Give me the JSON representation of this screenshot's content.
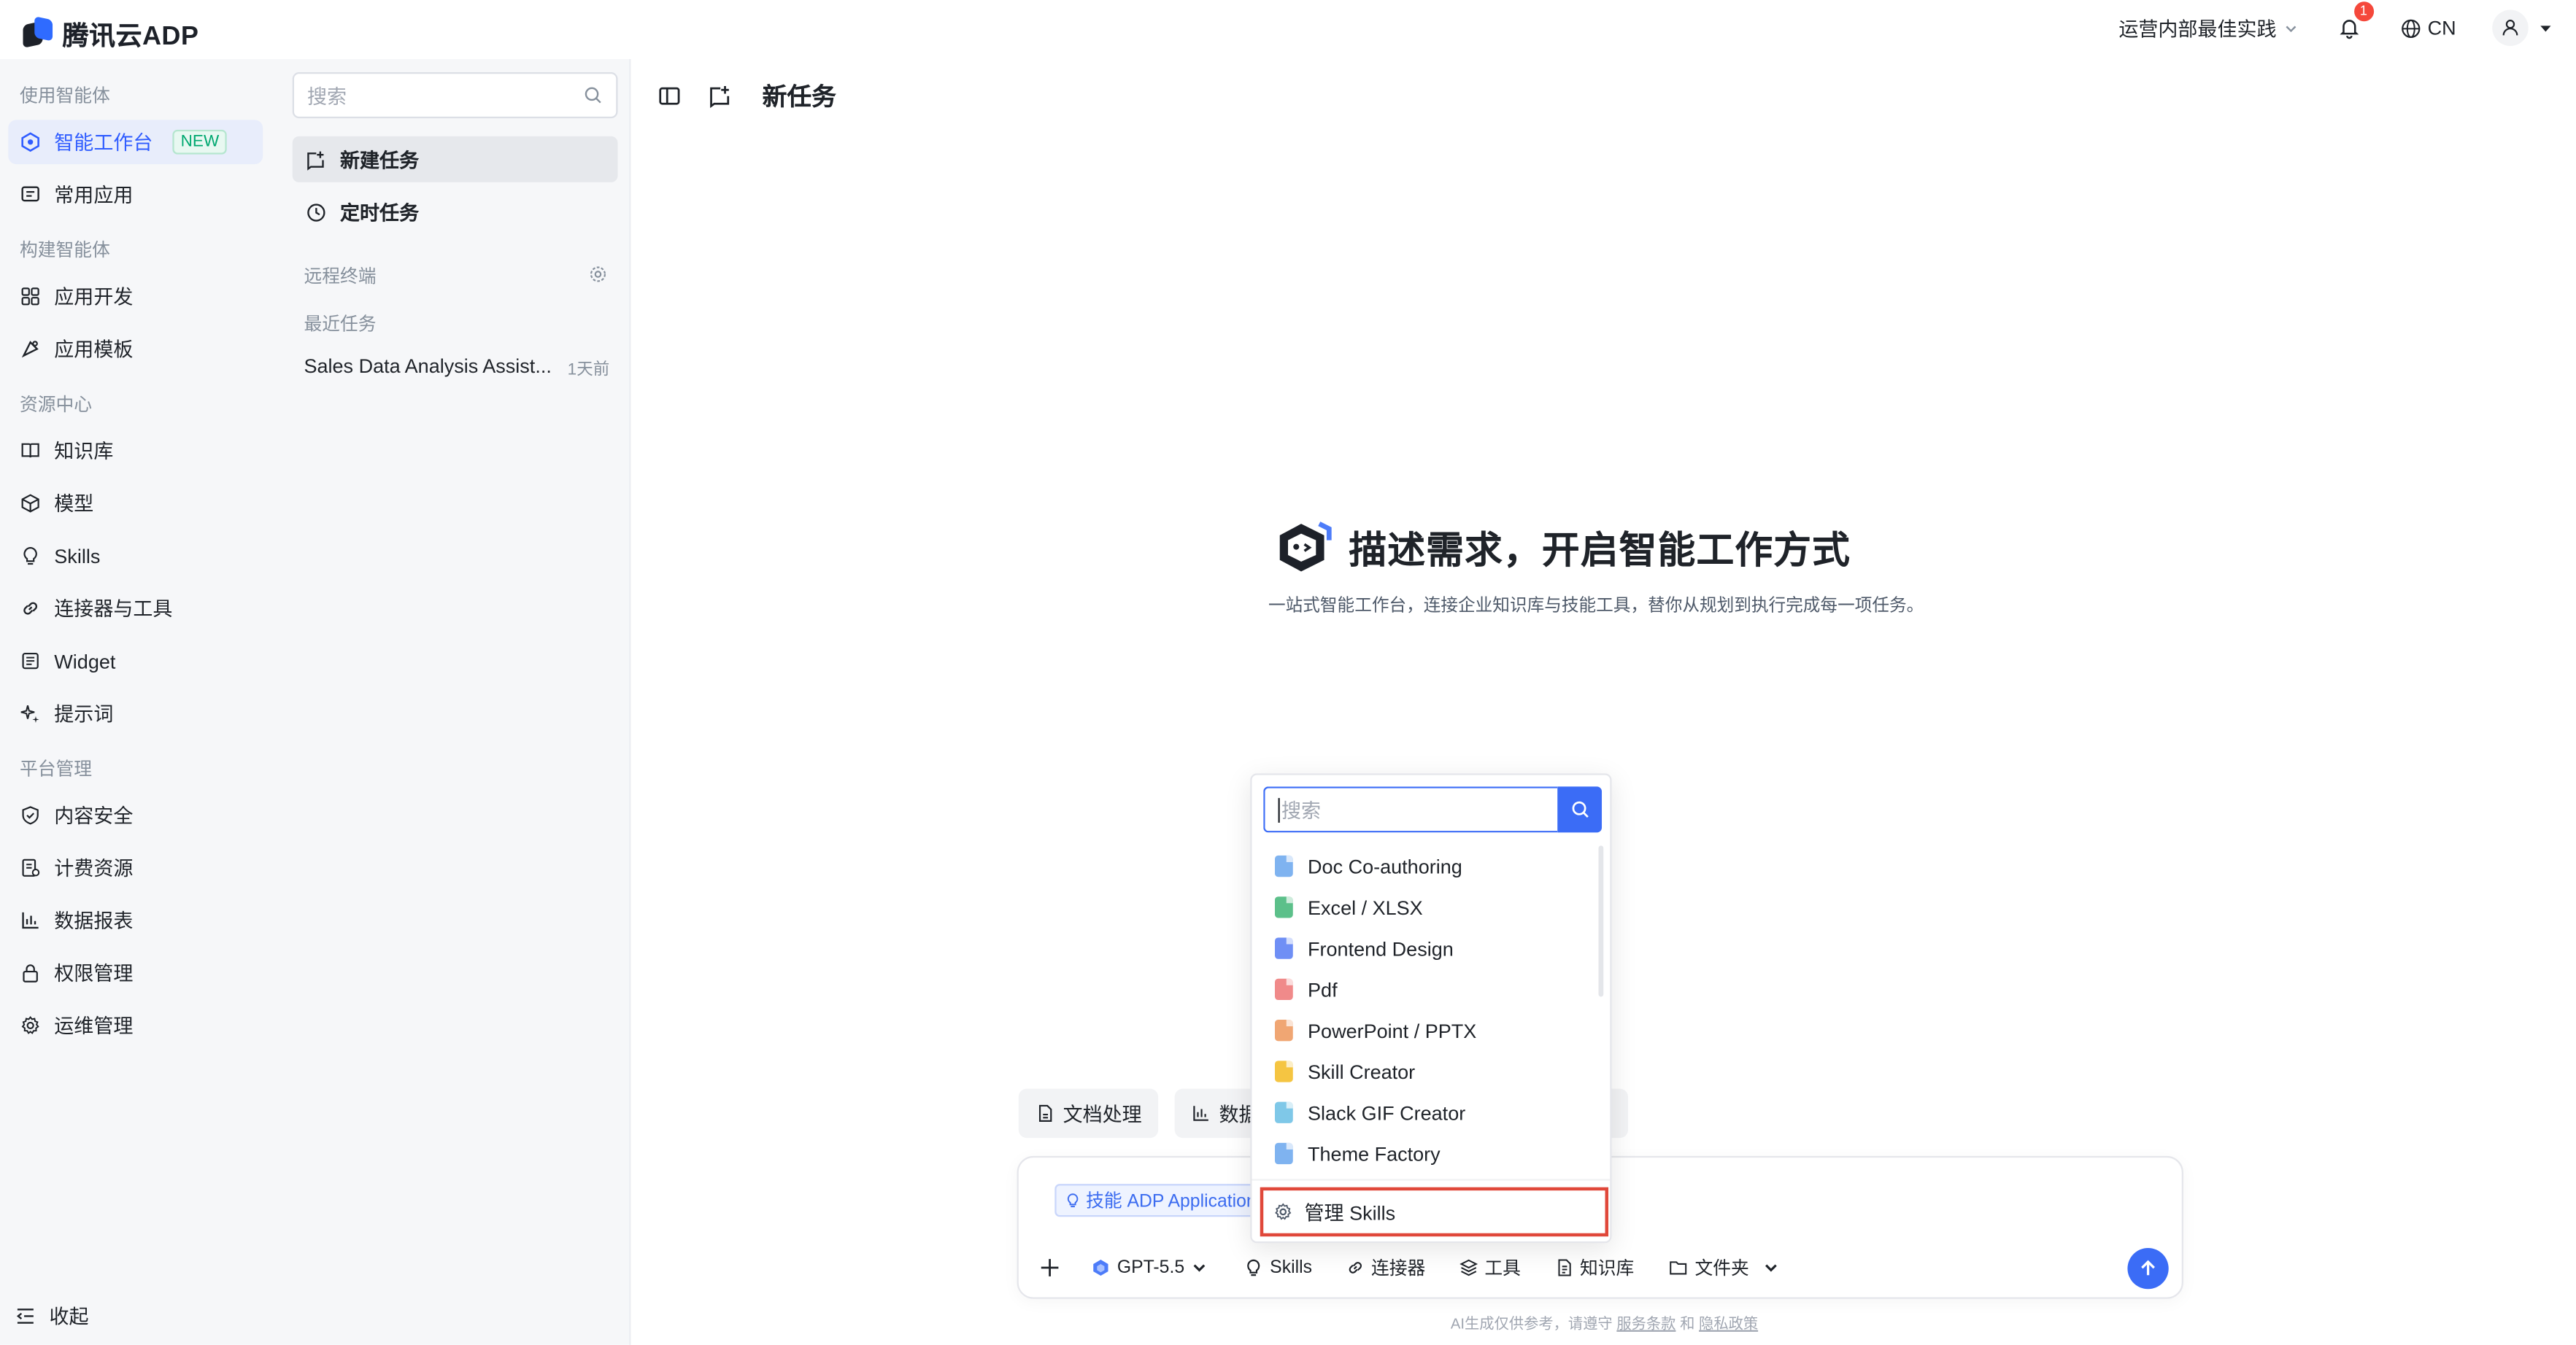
{
  "app": {
    "logo_text": "腾讯云ADP"
  },
  "topbar": {
    "workspace": "运营内部最佳实践",
    "notifications_count": "1",
    "language": "CN"
  },
  "sidebar": {
    "sections": {
      "use": "使用智能体",
      "build": "构建智能体",
      "resources": "资源中心",
      "platform": "平台管理"
    },
    "items": {
      "workbench": "智能工作台",
      "workbench_tag": "NEW",
      "apps": "常用应用",
      "app_dev": "应用开发",
      "app_templates": "应用模板",
      "knowledge": "知识库",
      "model": "模型",
      "skills": "Skills",
      "connectors": "连接器与工具",
      "widget": "Widget",
      "prompts": "提示词",
      "content_security": "内容安全",
      "billing": "计费资源",
      "reports": "数据报表",
      "permissions": "权限管理",
      "ops": "运维管理"
    },
    "collapse_label": "收起"
  },
  "task_panel": {
    "search_placeholder": "搜索",
    "new_task": "新建任务",
    "scheduled_task": "定时任务",
    "remote_terminal": "远程终端",
    "recent_tasks_label": "最近任务",
    "recent_tasks": [
      {
        "title": "Sales Data Analysis Assist...",
        "time": "1天前"
      }
    ]
  },
  "main": {
    "title": "新任务",
    "hero_title": "描述需求，开启智能工作方式",
    "hero_subtitle": "一站式智能工作台，连接企业知识库与技能工具，替你从规划到执行完成每一项任务。",
    "quick_actions": [
      "文档处理",
      "数据"
    ],
    "skill_chip": "技能 ADP Application"
  },
  "composer": {
    "model": "GPT-5.5",
    "tools": {
      "skills": "Skills",
      "connectors": "连接器",
      "tools": "工具",
      "knowledge": "知识库",
      "folder": "文件夹"
    },
    "footer_prefix": "AI生成仅供参考，请遵守",
    "terms": "服务条款",
    "and": "和",
    "privacy": "隐私政策"
  },
  "skills_dropdown": {
    "search_placeholder": "搜索",
    "items": [
      {
        "label": "Doc Co-authoring",
        "color": "#7fb3f0"
      },
      {
        "label": "Excel / XLSX",
        "color": "#5cc08a"
      },
      {
        "label": "Frontend Design",
        "color": "#6f8ff5"
      },
      {
        "label": "Pdf",
        "color": "#f08a8a"
      },
      {
        "label": "PowerPoint / PPTX",
        "color": "#f0a673"
      },
      {
        "label": "Skill Creator",
        "color": "#f5c542"
      },
      {
        "label": "Slack GIF Creator",
        "color": "#7fc8e8"
      },
      {
        "label": "Theme Factory",
        "color": "#7fb3f0"
      }
    ],
    "manage_label": "管理 Skills"
  },
  "colors": {
    "accent": "#3b6cf6",
    "active_nav_bg": "#e8edfb",
    "highlight_border": "#e0483a"
  }
}
